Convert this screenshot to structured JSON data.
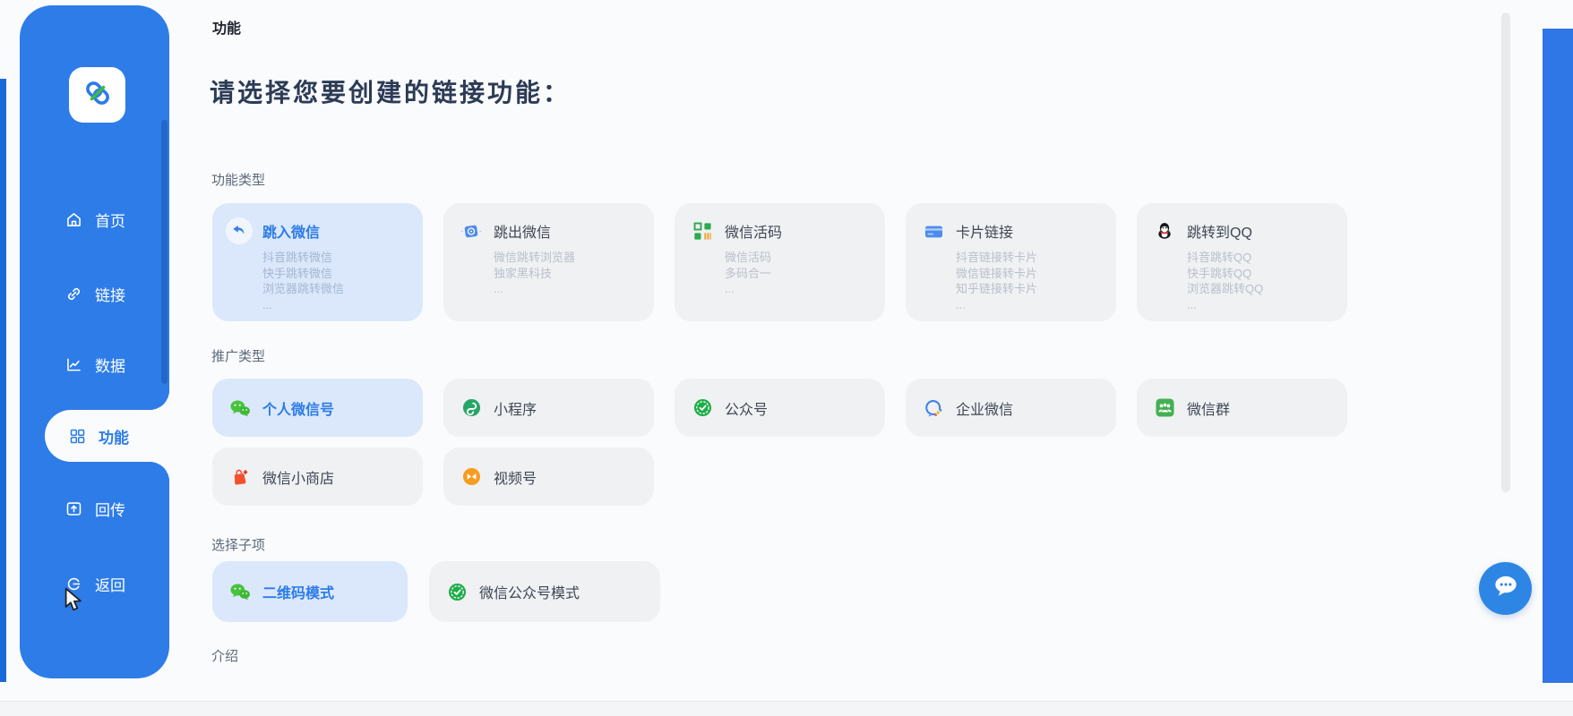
{
  "sidebar": {
    "logo_icon": "link-logo-icon",
    "items": [
      {
        "label": "首页",
        "icon": "home-icon",
        "active": false
      },
      {
        "label": "链接",
        "icon": "link-icon",
        "active": false
      },
      {
        "label": "数据",
        "icon": "chart-icon",
        "active": false
      },
      {
        "label": "功能",
        "icon": "grid-icon",
        "active": true
      },
      {
        "label": "回传",
        "icon": "upload-icon",
        "active": false
      },
      {
        "label": "返回",
        "icon": "back-icon",
        "active": false
      }
    ]
  },
  "page": {
    "breadcrumb": "功能",
    "title": "请选择您要创建的链接功能："
  },
  "sections": [
    {
      "label": "功能类型",
      "kind": "detailed",
      "cards": [
        {
          "title": "跳入微信",
          "icon": "jump-in-wechat-icon",
          "selected": true,
          "details": [
            "抖音跳转微信",
            "快手跳转微信",
            "浏览器跳转微信",
            "..."
          ]
        },
        {
          "title": "跳出微信",
          "icon": "jump-out-wechat-icon",
          "selected": false,
          "details": [
            "微信跳转浏览器",
            "独家黑科技",
            "..."
          ]
        },
        {
          "title": "微信活码",
          "icon": "wechat-live-qr-icon",
          "selected": false,
          "details": [
            "微信活码",
            "多码合一",
            "..."
          ]
        },
        {
          "title": "卡片链接",
          "icon": "card-link-icon",
          "selected": false,
          "details": [
            "抖音链接转卡片",
            "微信链接转卡片",
            "知乎链接转卡片",
            "..."
          ]
        },
        {
          "title": "跳转到QQ",
          "icon": "qq-icon",
          "selected": false,
          "details": [
            "抖音跳转QQ",
            "快手跳转QQ",
            "浏览器跳转QQ",
            "..."
          ]
        }
      ]
    },
    {
      "label": "推广类型",
      "kind": "compact",
      "cards": [
        {
          "title": "个人微信号",
          "icon": "wechat-icon",
          "selected": true
        },
        {
          "title": "小程序",
          "icon": "mini-program-icon",
          "selected": false
        },
        {
          "title": "公众号",
          "icon": "official-account-icon",
          "selected": false
        },
        {
          "title": "企业微信",
          "icon": "work-wechat-icon",
          "selected": false
        },
        {
          "title": "微信群",
          "icon": "wechat-group-icon",
          "selected": false
        },
        {
          "title": "微信小商店",
          "icon": "wechat-shop-icon",
          "selected": false
        },
        {
          "title": "视频号",
          "icon": "video-account-icon",
          "selected": false
        }
      ]
    },
    {
      "label": "选择子项",
      "kind": "subitem",
      "cards": [
        {
          "title": "二维码模式",
          "icon": "wechat-icon",
          "selected": true
        },
        {
          "title": "微信公众号模式",
          "icon": "official-account-icon",
          "selected": false
        }
      ]
    },
    {
      "label": "介绍",
      "kind": "empty",
      "cards": []
    }
  ],
  "chat_button": {
    "icon": "chat-bubble-icon"
  },
  "colors": {
    "sidebar_blue": "#2d7ce8",
    "accent_blue": "#2c7be8",
    "selected_card_bg": "#dbe8fb",
    "left_strip_blue": "#1a69d9",
    "right_strip_blue": "#2f76e6"
  }
}
